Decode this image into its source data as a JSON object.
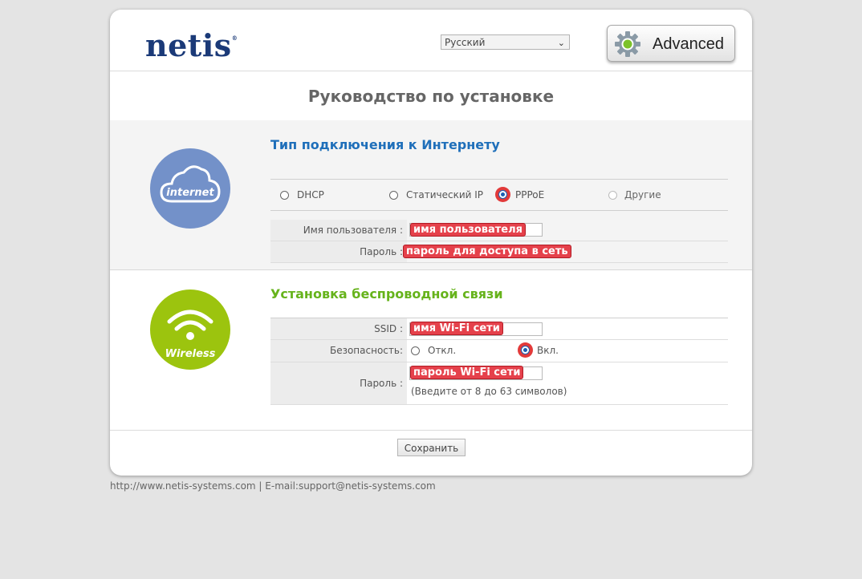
{
  "header": {
    "logo_text": "netis",
    "language": "Русский",
    "advanced_label": "Advanced"
  },
  "page_title": "Руководство по установке",
  "internet": {
    "title": "Тип подключения к Интернету",
    "icon_text": "internet",
    "connection_types": [
      {
        "label": "DHCP",
        "selected": false
      },
      {
        "label": "Статический IP",
        "selected": false
      },
      {
        "label": "PPPoE",
        "selected": true
      },
      {
        "label": "Другие",
        "selected": false
      }
    ],
    "username_label": "Имя пользователя :",
    "username_annotation": "имя пользователя",
    "password_label": "Пароль :",
    "password_annotation": "пароль для доступа в сеть"
  },
  "wireless": {
    "title": "Установка беспроводной связи",
    "icon_text": "Wireless",
    "ssid_label": "SSID :",
    "ssid_annotation": "имя Wi-Fi сети",
    "security_label": "Безопасность:",
    "security_options": [
      {
        "label": "Откл.",
        "selected": false
      },
      {
        "label": "Вкл.",
        "selected": true
      }
    ],
    "password_label": "Пароль :",
    "password_annotation": "пароль Wi-Fi сети",
    "password_hint": "(Введите от 8 до 63 символов)"
  },
  "save_label": "Сохранить",
  "footer": "http://www.netis-systems.com | E-mail:support@netis-systems.com",
  "colors": {
    "brand": "#1b3a78",
    "internet_accent": "#1f6fba",
    "wireless_accent": "#66b31b",
    "annotation": "#e5414b"
  }
}
